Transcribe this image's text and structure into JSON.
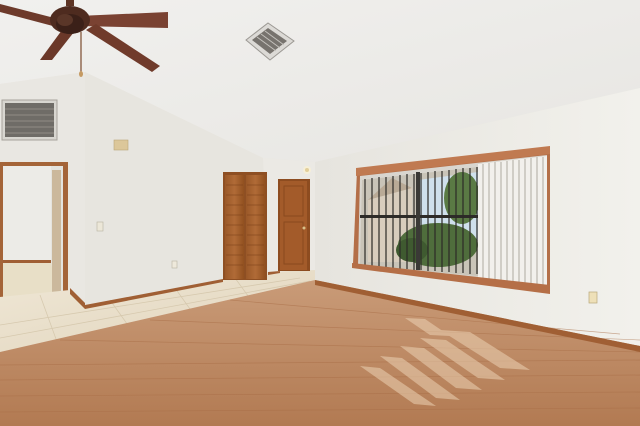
{
  "scene": {
    "colors": {
      "ceiling": "#efeeeb",
      "wall": "#ecebe6",
      "wall_shadow": "#e2e0da",
      "wood_floor": "#b9825b",
      "wood_floor_light": "#c99a74",
      "tile": "#e6dcc8",
      "door_wood": "#a1602f",
      "door_dark": "#8f4f24",
      "baseboard": "#a05f34",
      "fan_blade": "#6e3b27",
      "window_frame": "#b8714a",
      "blinds": "#f3f1ee",
      "foliage": "#4d6b3b"
    },
    "icons": [
      "ceiling-fan-icon",
      "air-vent-icon",
      "wall-vent-icon",
      "electrical-outlet-icon",
      "light-switch-icon"
    ]
  }
}
